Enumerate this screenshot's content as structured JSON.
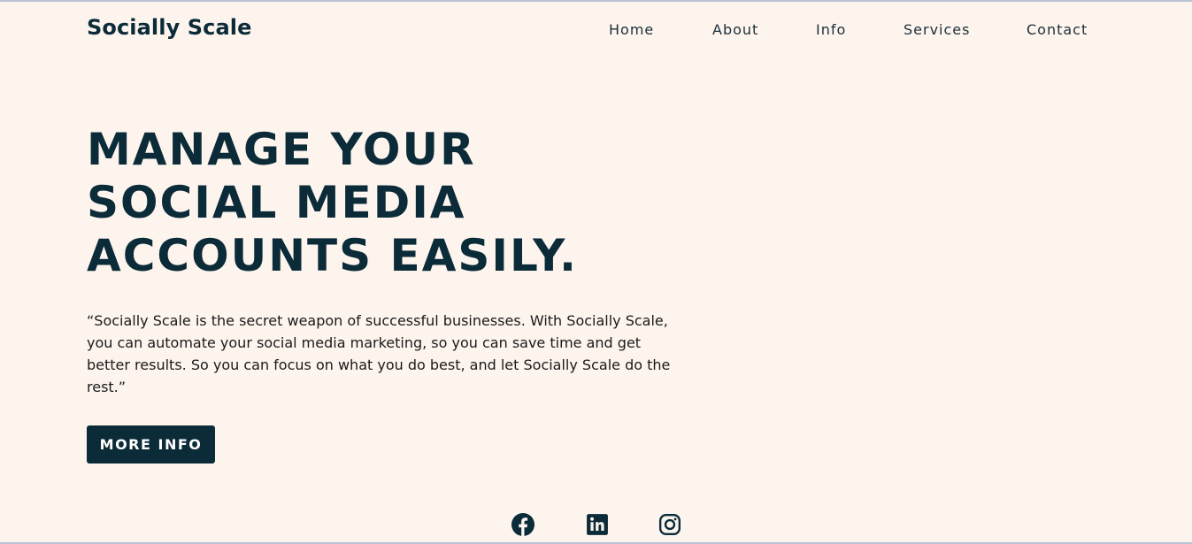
{
  "brand": {
    "name": "Socially Scale"
  },
  "nav": {
    "items": [
      {
        "label": "Home"
      },
      {
        "label": "About"
      },
      {
        "label": "Info"
      },
      {
        "label": "Services"
      },
      {
        "label": "Contact"
      }
    ]
  },
  "hero": {
    "title_lines": [
      "MANAGE YOUR",
      "SOCIAL MEDIA",
      "ACCOUNTS EASILY."
    ],
    "quote": "“Socially Scale is the secret weapon of successful businesses. With Socially Scale, you can automate your social media marketing, so you can save time and get better results. So you can focus on what you do best, and let Socially Scale do the rest.”",
    "button_label": "MORE INFO"
  },
  "social": {
    "icons": [
      "facebook-icon",
      "linkedin-icon",
      "instagram-icon"
    ]
  },
  "colors": {
    "background": "#fdf4ee",
    "primary": "#0b2b38",
    "button_text": "#ffffff"
  }
}
